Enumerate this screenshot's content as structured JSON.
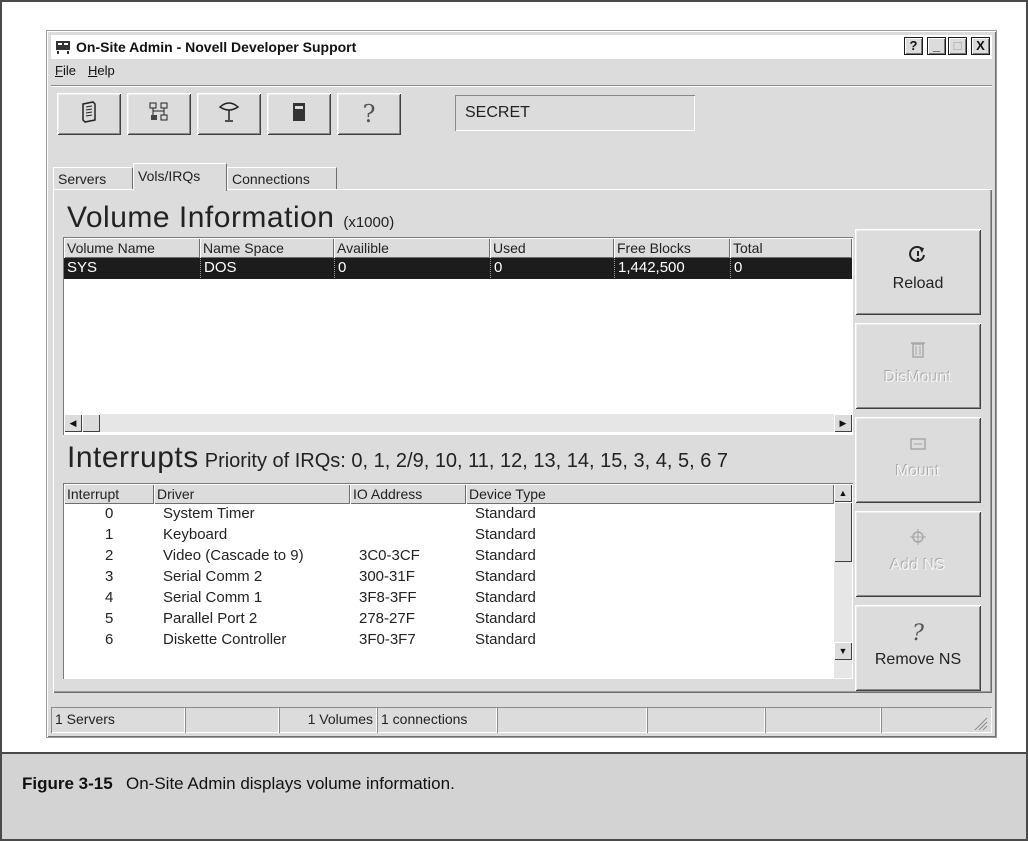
{
  "window": {
    "title": "On-Site Admin - Novell Developer Support",
    "controls": {
      "help": "?",
      "minimize": "_",
      "maximize": "□",
      "close": "X"
    }
  },
  "menu": [
    {
      "label": "File"
    },
    {
      "label": "Help"
    }
  ],
  "toolbar": {
    "buttons": [
      {
        "icon": "server-tower-icon"
      },
      {
        "icon": "network-icon"
      },
      {
        "icon": "satellite-dish-icon"
      },
      {
        "icon": "disk-drive-icon"
      },
      {
        "icon": "help-icon",
        "label": "?"
      }
    ],
    "server_name": "SECRET"
  },
  "tabs": [
    {
      "label": "Servers",
      "active": false
    },
    {
      "label": "Vols/IRQs",
      "active": true
    },
    {
      "label": "Connections",
      "active": false
    }
  ],
  "volumes": {
    "title": "Volume Information",
    "title_suffix": "(x1000)",
    "columns": [
      "Volume Name",
      "Name Space",
      "Availible",
      "Used",
      "Free Blocks",
      "Total"
    ],
    "rows": [
      [
        "SYS",
        "DOS",
        "0",
        "0",
        "1,442,500",
        "0"
      ]
    ]
  },
  "interrupts": {
    "title": "Interrupts",
    "priority": "Priority of IRQs: 0, 1, 2/9, 10, 11, 12, 13, 14, 15, 3, 4, 5, 6 7",
    "columns": [
      "Interrupt",
      "Driver",
      "IO Address",
      "Device Type"
    ],
    "rows": [
      [
        "0",
        "System Timer",
        "",
        "Standard"
      ],
      [
        "1",
        "Keyboard",
        "",
        "Standard"
      ],
      [
        "2",
        "Video (Cascade to 9)",
        "3C0-3CF",
        "Standard"
      ],
      [
        "3",
        "Serial Comm 2",
        "300-31F",
        "Standard"
      ],
      [
        "4",
        "Serial Comm 1",
        "3F8-3FF",
        "Standard"
      ],
      [
        "5",
        "Parallel Port 2",
        "278-27F",
        "Standard"
      ],
      [
        "6",
        "Diskette Controller",
        "3F0-3F7",
        "Standard"
      ]
    ]
  },
  "side_buttons": [
    {
      "label": "Reload",
      "icon": "reload-icon",
      "enabled": true
    },
    {
      "label": "DisMount",
      "icon": "trash-icon",
      "enabled": false
    },
    {
      "label": "Mount",
      "icon": "mount-icon",
      "enabled": false
    },
    {
      "label": "Add NS",
      "icon": "add-namespace-icon",
      "enabled": false
    },
    {
      "label": "Remove NS",
      "icon": "question-icon",
      "enabled": true
    }
  ],
  "status": {
    "servers": "1 Servers",
    "volumes": "1 Volumes",
    "connections": "1 connections"
  },
  "caption": {
    "label": "Figure 3-15",
    "text": "On-Site Admin displays volume information."
  }
}
